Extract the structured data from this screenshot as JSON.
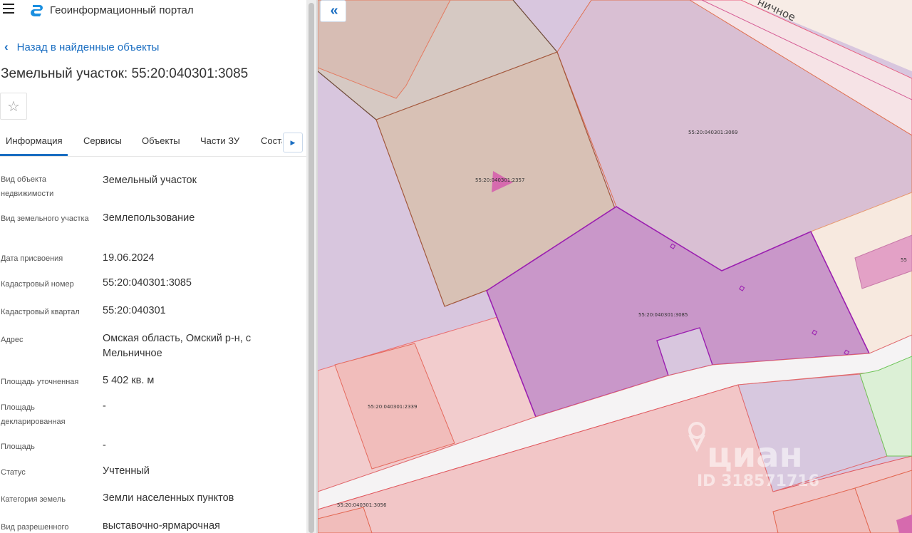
{
  "header": {
    "menu_icon": "hamburger-icon",
    "logo_icon": "portal-logo-icon",
    "title": "Геоинформационный портал"
  },
  "back_link": {
    "label": "Назад в найденные объекты",
    "icon": "chevron-left-icon"
  },
  "page_title": "Земельный участок: 55:20:040301:3085",
  "favorite": {
    "icon": "star-icon"
  },
  "tabs": [
    {
      "label": "Информация",
      "active": true
    },
    {
      "label": "Сервисы"
    },
    {
      "label": "Объекты"
    },
    {
      "label": "Части ЗУ"
    },
    {
      "label": "Соста"
    }
  ],
  "tab_scroll_icon": "caret-right-icon",
  "attributes": [
    {
      "label": "Вид объекта недвижимости",
      "value": "Земельный участок"
    },
    {
      "label": "Вид земельного участка",
      "value": "Землепользование"
    },
    {
      "label": "Дата присвоения",
      "value": "19.06.2024"
    },
    {
      "label": "Кадастровый номер",
      "value": "55:20:040301:3085"
    },
    {
      "label": "Кадастровый квартал",
      "value": "55:20:040301"
    },
    {
      "label": "Адрес",
      "value": "Омская область, Омский р-н, с Мельничное"
    },
    {
      "label": "Площадь уточненная",
      "value": "5 402 кв. м"
    },
    {
      "label": "Площадь декларированная",
      "value": "-"
    },
    {
      "label": "Площадь",
      "value": "-"
    },
    {
      "label": "Статус",
      "value": "Учтенный"
    },
    {
      "label": "Категория земель",
      "value": "Земли населенных пунктов"
    },
    {
      "label": "Вид разрешенного",
      "value": "выставочно-ярмарочная"
    }
  ],
  "map": {
    "collapse_icon": "double-chevron-left-icon",
    "street_label": "ничное",
    "parcel_labels": [
      "55:20:040301:3069",
      "55:20:040301:2357",
      "55:20:040301:3085",
      "55:20:040301:2339",
      "55:20:040301:3056",
      "55"
    ],
    "watermark": {
      "brand": "циан",
      "id_text": "ID 318571716"
    },
    "colors": {
      "selected_fill": "#c997c9",
      "selected_stroke": "#9b1fb0",
      "brown_fill": "#d8c1b5",
      "lavender_fill": "#d8c6de",
      "pink_fill": "#f2cccd",
      "salmon_fill": "#f1bdbb",
      "road_fill": "#f5f3f4",
      "green_fill": "#dcf0d6",
      "beige_fill": "#f7e9df"
    }
  }
}
